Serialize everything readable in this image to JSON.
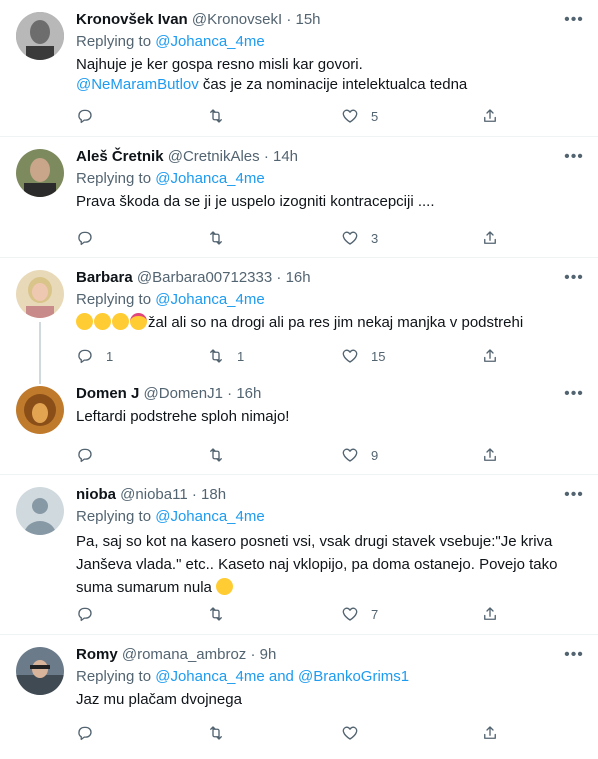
{
  "tweets": [
    {
      "name": "Kronovšek Ivan",
      "handle": "@KronovsekI",
      "sep": "·",
      "time": "15h",
      "replying_prefix": "Replying to",
      "replying_to": "@Johanca_4me",
      "text_line1": "Najhuje je ker gospa resno misli kar govori.",
      "text_mention": "@NeMaramButlov",
      "text_line2_rest": " čas je za  nominacije  intelektualca tedna",
      "replies": "",
      "retweets": "",
      "likes": "5"
    },
    {
      "name": "Aleš Čretnik",
      "handle": "@CretnikAles",
      "sep": "·",
      "time": "14h",
      "replying_prefix": "Replying to",
      "replying_to": "@Johanca_4me",
      "text": "Prava škoda da se ji je uspelo izogniti kontracepciji ....",
      "replies": "",
      "retweets": "",
      "likes": "3"
    },
    {
      "name": "Barbara",
      "handle": "@Barbara00712333",
      "sep": "·",
      "time": "16h",
      "replying_prefix": "Replying to",
      "replying_to": "@Johanca_4me",
      "text": "žal ali so na drogi ali pa res jim nekaj manjka v podstrehi",
      "replies": "1",
      "retweets": "1",
      "likes": "15"
    },
    {
      "name": "Domen J",
      "handle": "@DomenJ1",
      "sep": "·",
      "time": "16h",
      "text": "Leftardi podstrehe sploh nimajo!",
      "replies": "",
      "retweets": "",
      "likes": "9"
    },
    {
      "name": "nioba",
      "handle": "@nioba11",
      "sep": "·",
      "time": "18h",
      "replying_prefix": "Replying to",
      "replying_to": "@Johanca_4me",
      "text_line1": "Pa, saj so kot na kasero posneti vsi, vsak drugi stavek vsebuje:\"Je kriva",
      "text_line2": "Janševa vlada.\" etc.. Kaseto naj vklopijo, pa doma ostanejo. Povejo tako",
      "text_line3": "suma sumarum nula",
      "replies": "",
      "retweets": "",
      "likes": "7"
    },
    {
      "name": "Romy",
      "handle": "@romana_ambroz",
      "sep": "·",
      "time": "9h",
      "replying_prefix": "Replying to",
      "replying_to": "@Johanca_4me and @BrankoGrims1",
      "text": "Jaz mu plačam dvojnega",
      "replies": "",
      "retweets": "",
      "likes": ""
    }
  ],
  "icons": {
    "reply": "reply-icon",
    "retweet": "retweet-icon",
    "like": "like-icon",
    "share": "share-icon",
    "more": "more-icon"
  },
  "colors": {
    "link": "#1d9bf0",
    "secondary": "#536471",
    "text": "#0f1419",
    "divider": "#eff3f4"
  }
}
